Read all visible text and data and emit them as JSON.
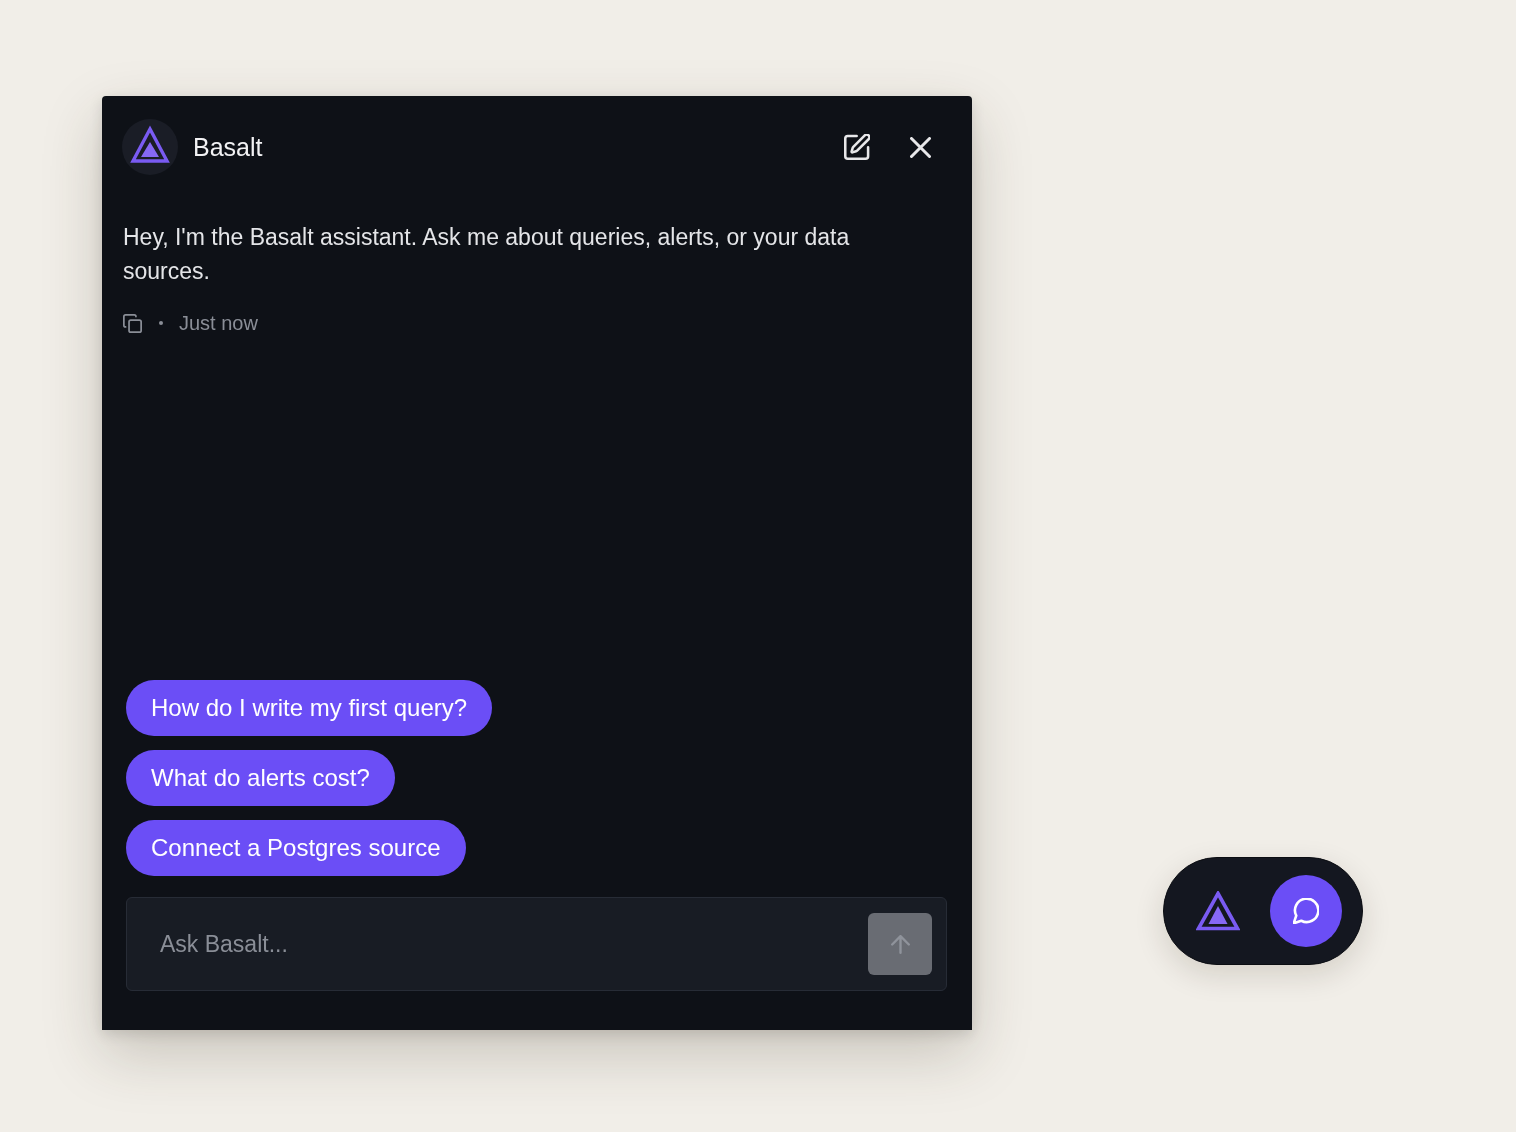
{
  "assistant_panel": {
    "header": {
      "title": "Basalt"
    },
    "message": {
      "text": "Hey, I'm the Basalt assistant. Ask me about queries, alerts, or your data sources.",
      "timestamp": "Just now"
    },
    "suggestions": [
      {
        "label": "How do I write my first query?"
      },
      {
        "label": "What do alerts cost?"
      },
      {
        "label": "Connect a Postgres source"
      }
    ],
    "composer": {
      "placeholder": "Ask Basalt...",
      "send_disabled": true
    }
  }
}
